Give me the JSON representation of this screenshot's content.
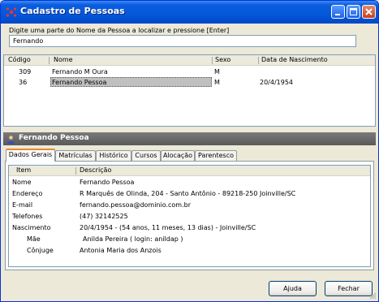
{
  "window": {
    "title": "Cadastro de Pessoas"
  },
  "search": {
    "prompt": "Digite uma parte do Nome da Pessoa a localizar e pressione [Enter]",
    "value": "Fernando"
  },
  "results": {
    "headers": [
      "Código",
      "Nome",
      "Sexo",
      "Data de Nascimento"
    ],
    "rows": [
      [
        "309",
        "Fernando M Oura",
        "M",
        ""
      ],
      [
        "36",
        "Fernando Pessoa",
        "M",
        "20/4/1954"
      ]
    ]
  },
  "detail": {
    "title": "Fernando Pessoa",
    "tabs": [
      "Dados Gerais",
      "Matrículas",
      "Histórico",
      "Cursos",
      "Alocação",
      "Parentesco"
    ],
    "headers": [
      "Item",
      "Descrição"
    ],
    "rows": [
      [
        "Nome",
        "Fernando Pessoa"
      ],
      [
        "Endereço",
        "R Marquês de Olinda, 204 - Santo Antônio - 89218-250 Joinville/SC"
      ],
      [
        "E-mail",
        "fernando.pessoa@dominio.com.br"
      ],
      [
        "Telefones",
        "(47) 32142525"
      ],
      [
        "Nascimento",
        "20/4/1954 -  (54 anos, 11 meses, 13 dias) - Joinville/SC"
      ],
      [
        "Mãe",
        "Anilda Pereira ( login: anildap )"
      ],
      [
        "Cônjuge",
        "Antonia Maria dos Anzois"
      ]
    ]
  },
  "buttons": {
    "help": "Ajuda",
    "close": "Fechar"
  }
}
